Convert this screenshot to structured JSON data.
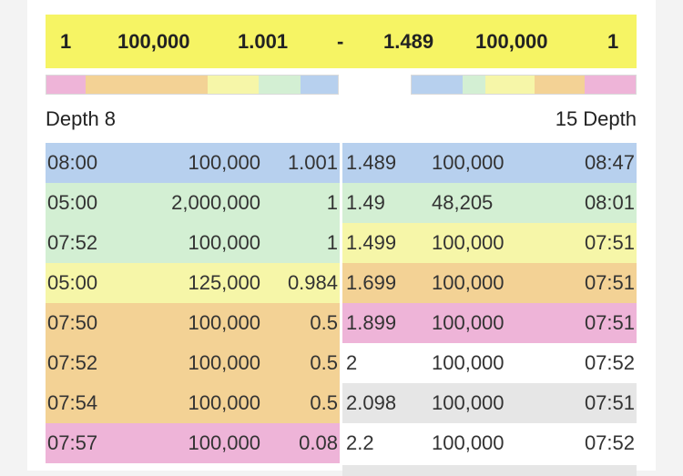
{
  "colors": {
    "blue": "#b7d0ee",
    "green": "#d3efd3",
    "yellow": "#f6f6a8",
    "orange": "#f3d295",
    "pink": "#eeb4d8",
    "grey": "#e6e6e6",
    "white": "#ffffff",
    "summary_bg": "#f6f464"
  },
  "summary": {
    "bid_count": "1",
    "bid_size": "100,000",
    "bid_price": "1.001",
    "separator": "-",
    "ask_price": "1.489",
    "ask_size": "100,000",
    "ask_count": "1"
  },
  "depth": {
    "left_label": "Depth",
    "left_value": "8",
    "right_value": "15",
    "right_label": "Depth"
  },
  "bid_depth_bar": [
    "pink",
    "orange",
    "yellow",
    "green",
    "blue"
  ],
  "ask_depth_bar": [
    "blue",
    "green",
    "yellow",
    "orange",
    "pink"
  ],
  "bids": [
    {
      "time": "08:00",
      "size": "100,000",
      "price": "1.001",
      "color": "blue"
    },
    {
      "time": "05:00",
      "size": "2,000,000",
      "price": "1",
      "color": "green"
    },
    {
      "time": "07:52",
      "size": "100,000",
      "price": "1",
      "color": "green"
    },
    {
      "time": "05:00",
      "size": "125,000",
      "price": "0.984",
      "color": "yellow"
    },
    {
      "time": "07:50",
      "size": "100,000",
      "price": "0.5",
      "color": "orange"
    },
    {
      "time": "07:52",
      "size": "100,000",
      "price": "0.5",
      "color": "orange"
    },
    {
      "time": "07:54",
      "size": "100,000",
      "price": "0.5",
      "color": "orange"
    },
    {
      "time": "07:57",
      "size": "100,000",
      "price": "0.08",
      "color": "pink"
    }
  ],
  "asks": [
    {
      "price": "1.489",
      "size": "100,000",
      "time": "08:47",
      "color": "blue"
    },
    {
      "price": "1.49",
      "size": "48,205",
      "time": "08:01",
      "color": "green"
    },
    {
      "price": "1.499",
      "size": "100,000",
      "time": "07:51",
      "color": "yellow"
    },
    {
      "price": "1.699",
      "size": "100,000",
      "time": "07:51",
      "color": "orange"
    },
    {
      "price": "1.899",
      "size": "100,000",
      "time": "07:51",
      "color": "pink"
    },
    {
      "price": "2",
      "size": "100,000",
      "time": "07:52",
      "color": "white"
    },
    {
      "price": "2.098",
      "size": "100,000",
      "time": "07:51",
      "color": "grey"
    },
    {
      "price": "2.2",
      "size": "100,000",
      "time": "07:52",
      "color": "white"
    }
  ]
}
